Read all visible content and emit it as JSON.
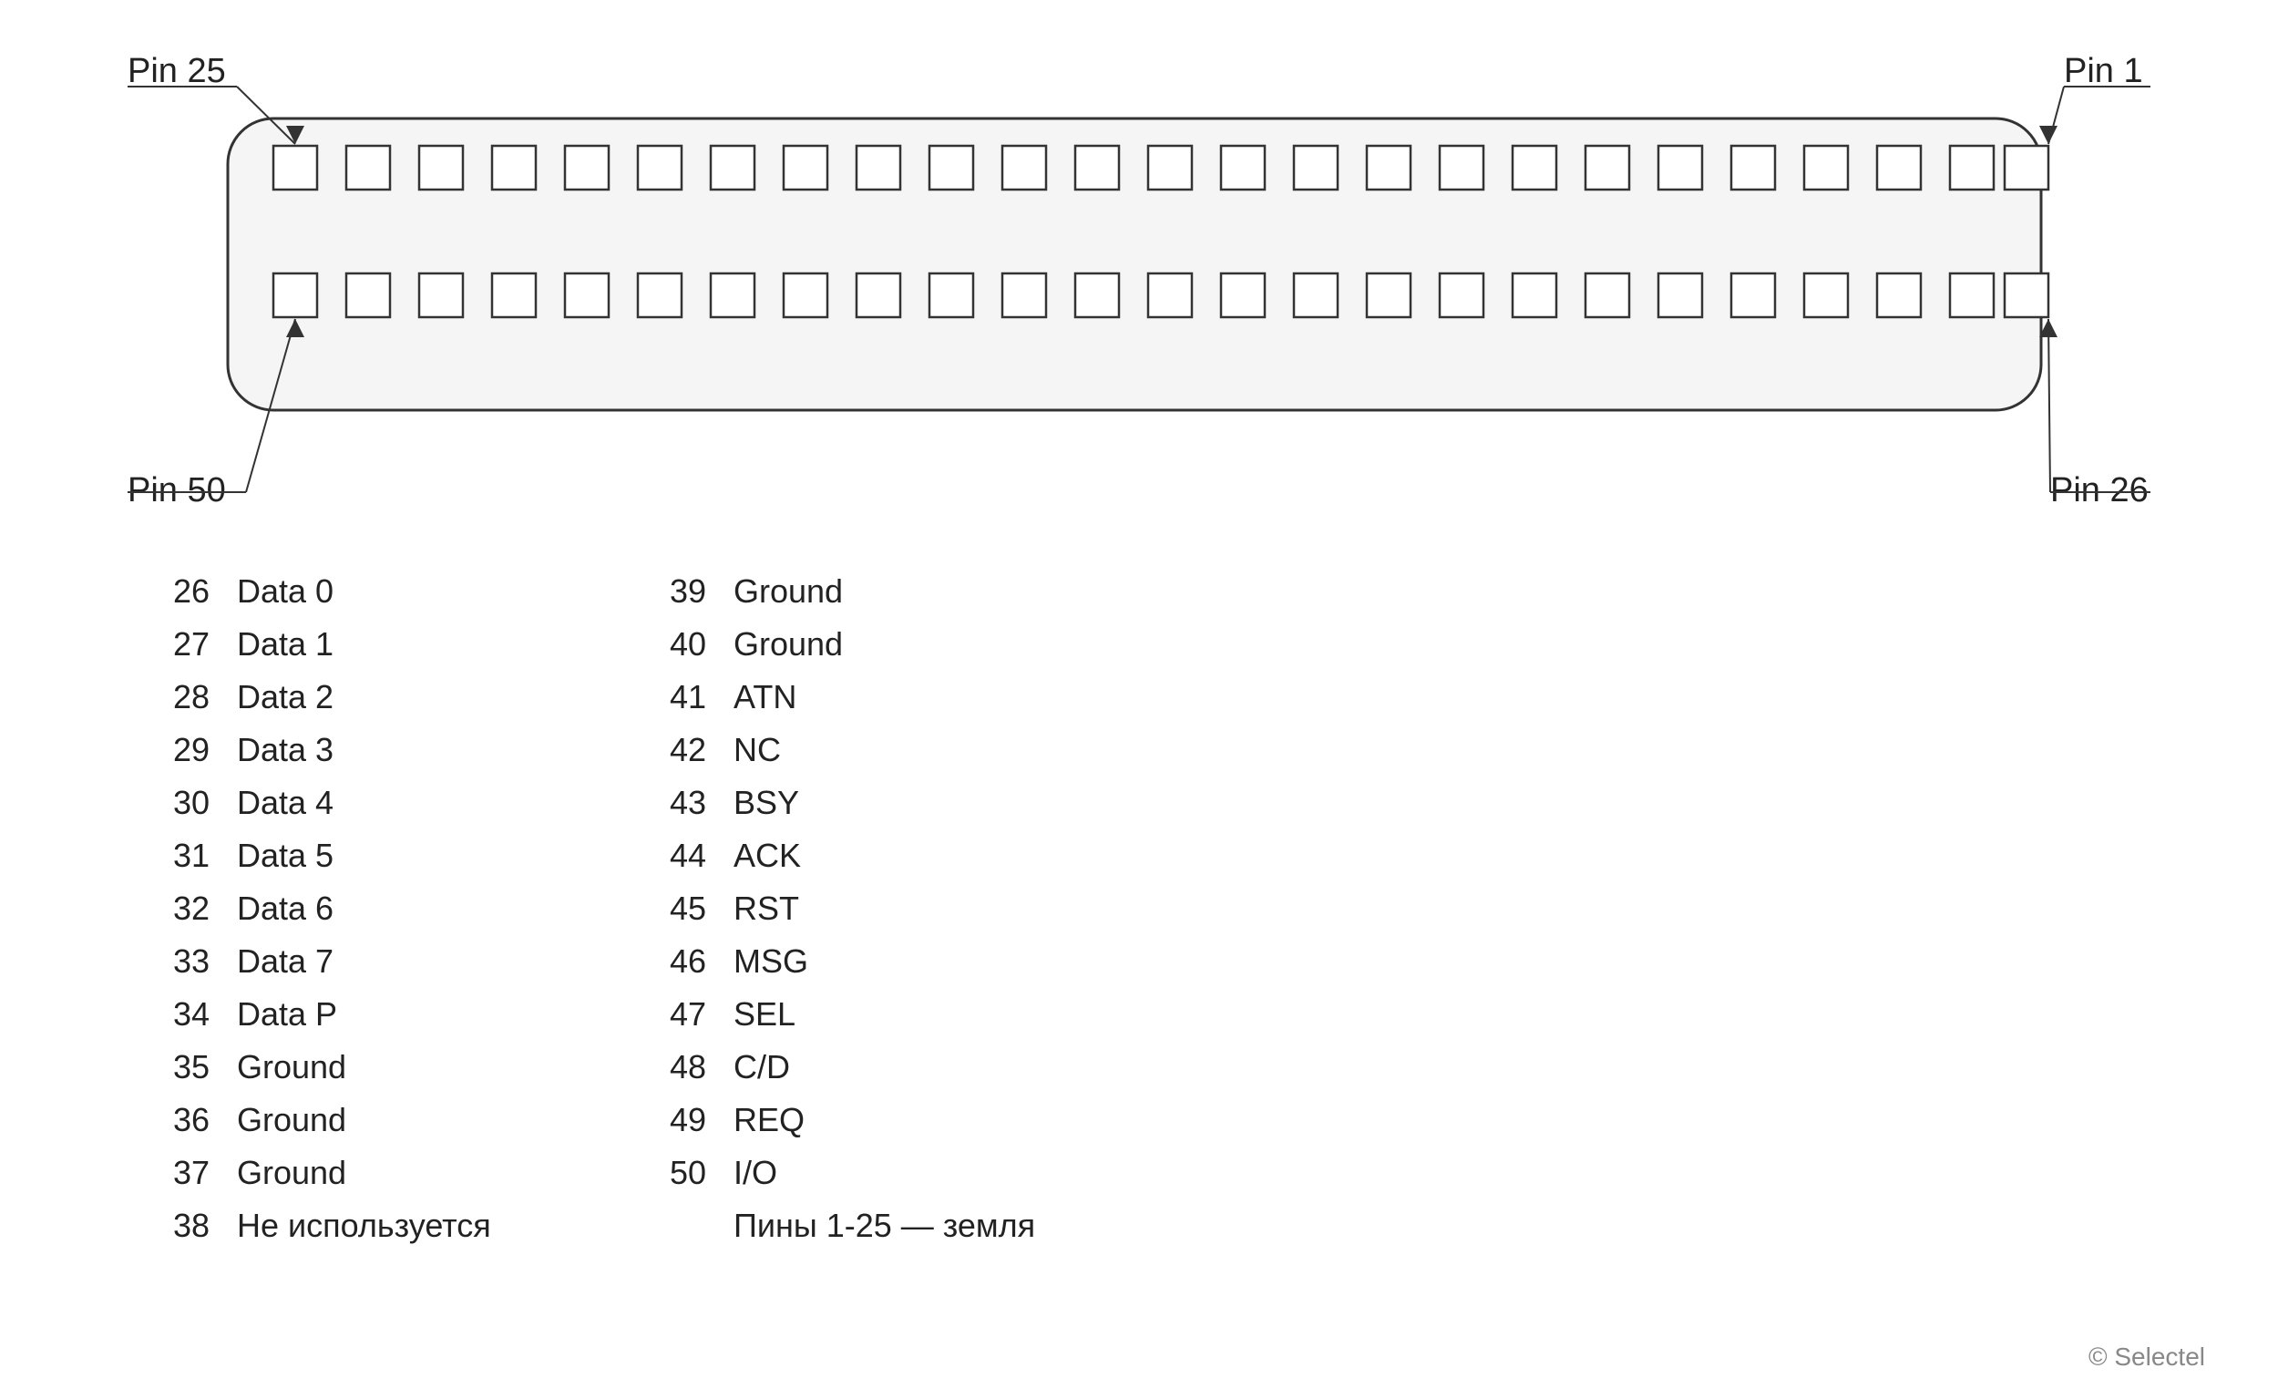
{
  "connector": {
    "pin_top_left": "Pin 25",
    "pin_top_right": "Pin 1",
    "pin_bottom_left": "Pin 50",
    "pin_bottom_right": "Pin 26",
    "top_row_count": 25,
    "bottom_row_count": 25
  },
  "pin_column_left": [
    {
      "number": "26",
      "name": "Data 0"
    },
    {
      "number": "27",
      "name": "Data 1"
    },
    {
      "number": "28",
      "name": "Data 2"
    },
    {
      "number": "29",
      "name": "Data 3"
    },
    {
      "number": "30",
      "name": "Data 4"
    },
    {
      "number": "31",
      "name": "Data 5"
    },
    {
      "number": "32",
      "name": "Data 6"
    },
    {
      "number": "33",
      "name": "Data 7"
    },
    {
      "number": "34",
      "name": "Data P"
    },
    {
      "number": "35",
      "name": "Ground"
    },
    {
      "number": "36",
      "name": "Ground"
    },
    {
      "number": "37",
      "name": "Ground"
    },
    {
      "number": "38",
      "name": "Не используется"
    }
  ],
  "pin_column_right": [
    {
      "number": "39",
      "name": "Ground"
    },
    {
      "number": "40",
      "name": "Ground"
    },
    {
      "number": "41",
      "name": "ATN"
    },
    {
      "number": "42",
      "name": "NC"
    },
    {
      "number": "43",
      "name": "BSY"
    },
    {
      "number": "44",
      "name": "ACK"
    },
    {
      "number": "45",
      "name": "RST"
    },
    {
      "number": "46",
      "name": "MSG"
    },
    {
      "number": "47",
      "name": "SEL"
    },
    {
      "number": "48",
      "name": "C/D"
    },
    {
      "number": "49",
      "name": "REQ"
    },
    {
      "number": "50",
      "name": "I/O"
    },
    {
      "number": "",
      "name": "Пины 1-25 — земля"
    }
  ],
  "copyright": "© Selectel"
}
